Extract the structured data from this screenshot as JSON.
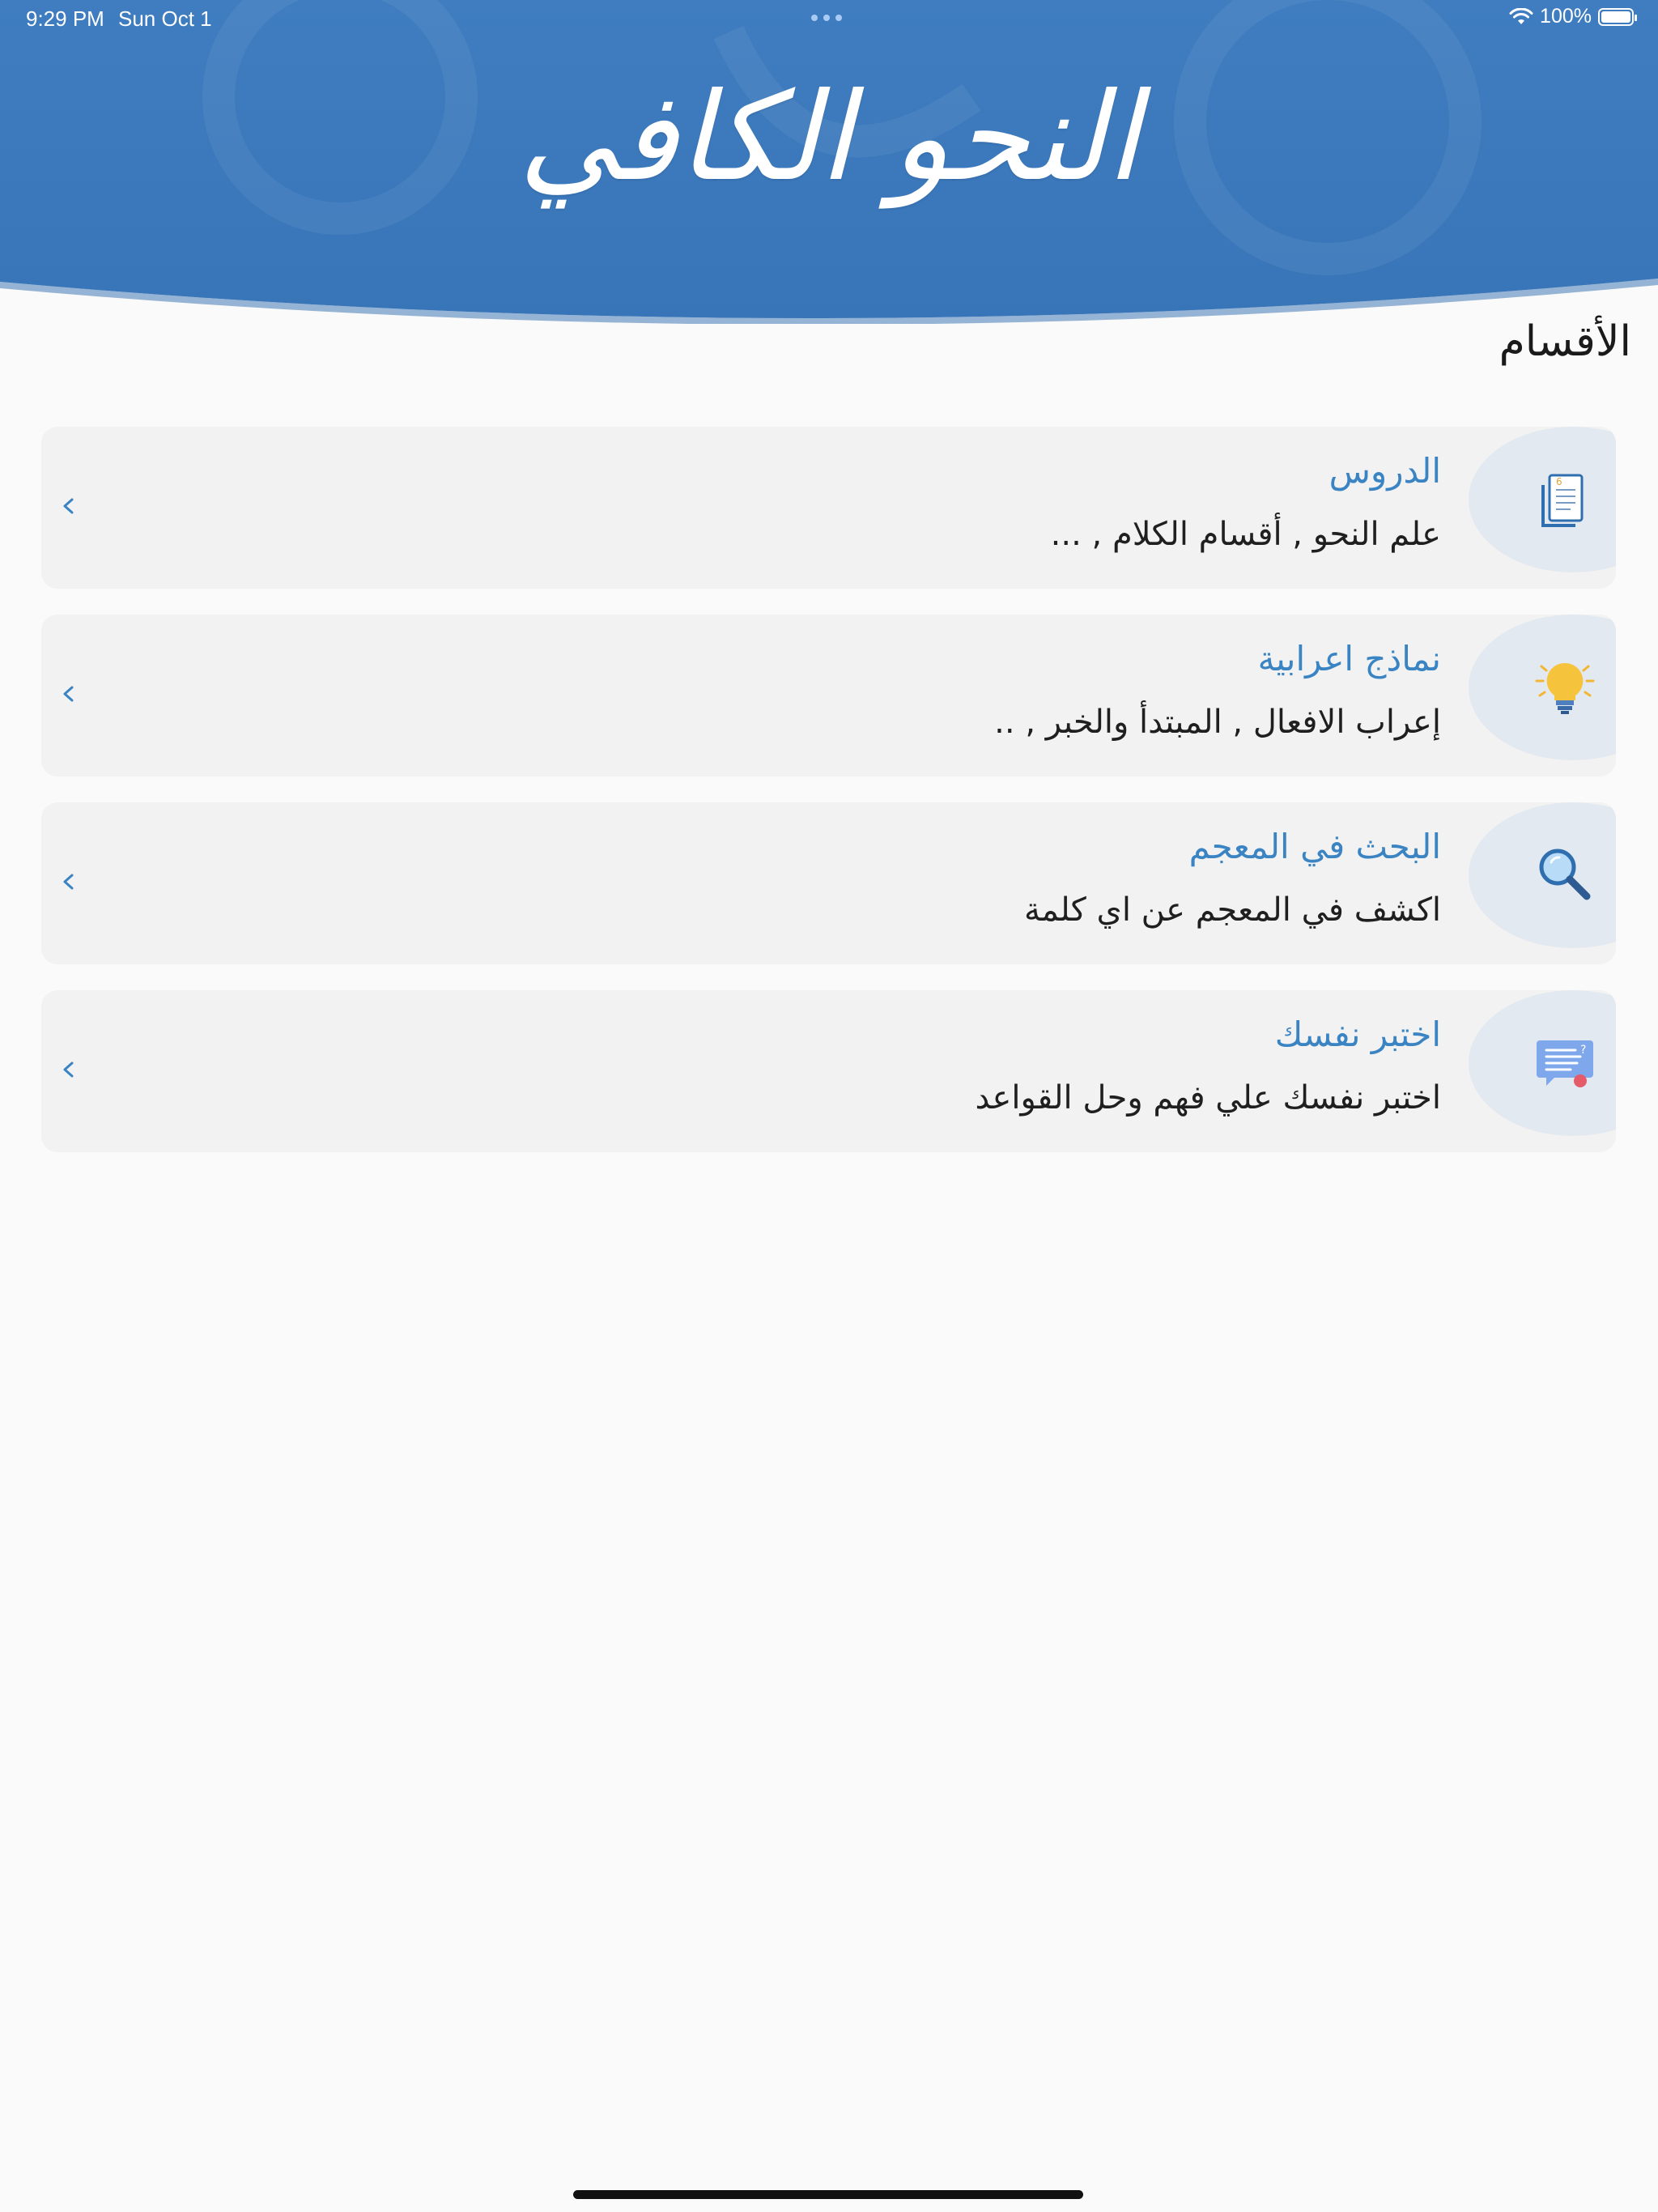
{
  "status_bar": {
    "time": "9:29 PM",
    "date": "Sun Oct 1",
    "battery": "100%"
  },
  "header": {
    "title": "النحو الكافي",
    "background_color": "#3d7cc0"
  },
  "section_title": "الأقسام",
  "cards": [
    {
      "title": "الدروس",
      "subtitle": "علم النحو , أقسام الكلام , ...",
      "icon": "document-icon"
    },
    {
      "title": "نماذج اعرابية",
      "subtitle": "إعراب الافعال , المبتدأ والخبر , ..",
      "icon": "lightbulb-icon"
    },
    {
      "title": "البحث في المعجم",
      "subtitle": "اكشف في المعجم عن اي كلمة",
      "icon": "magnifier-icon"
    },
    {
      "title": "اختبر نفسك",
      "subtitle": "اختبر نفسك علي فهم وحل القواعد",
      "icon": "quiz-chat-icon"
    }
  ],
  "colors": {
    "accent": "#3a84c3",
    "card_bg": "#f2f2f2",
    "icon_circle": "#e3e9f1"
  }
}
